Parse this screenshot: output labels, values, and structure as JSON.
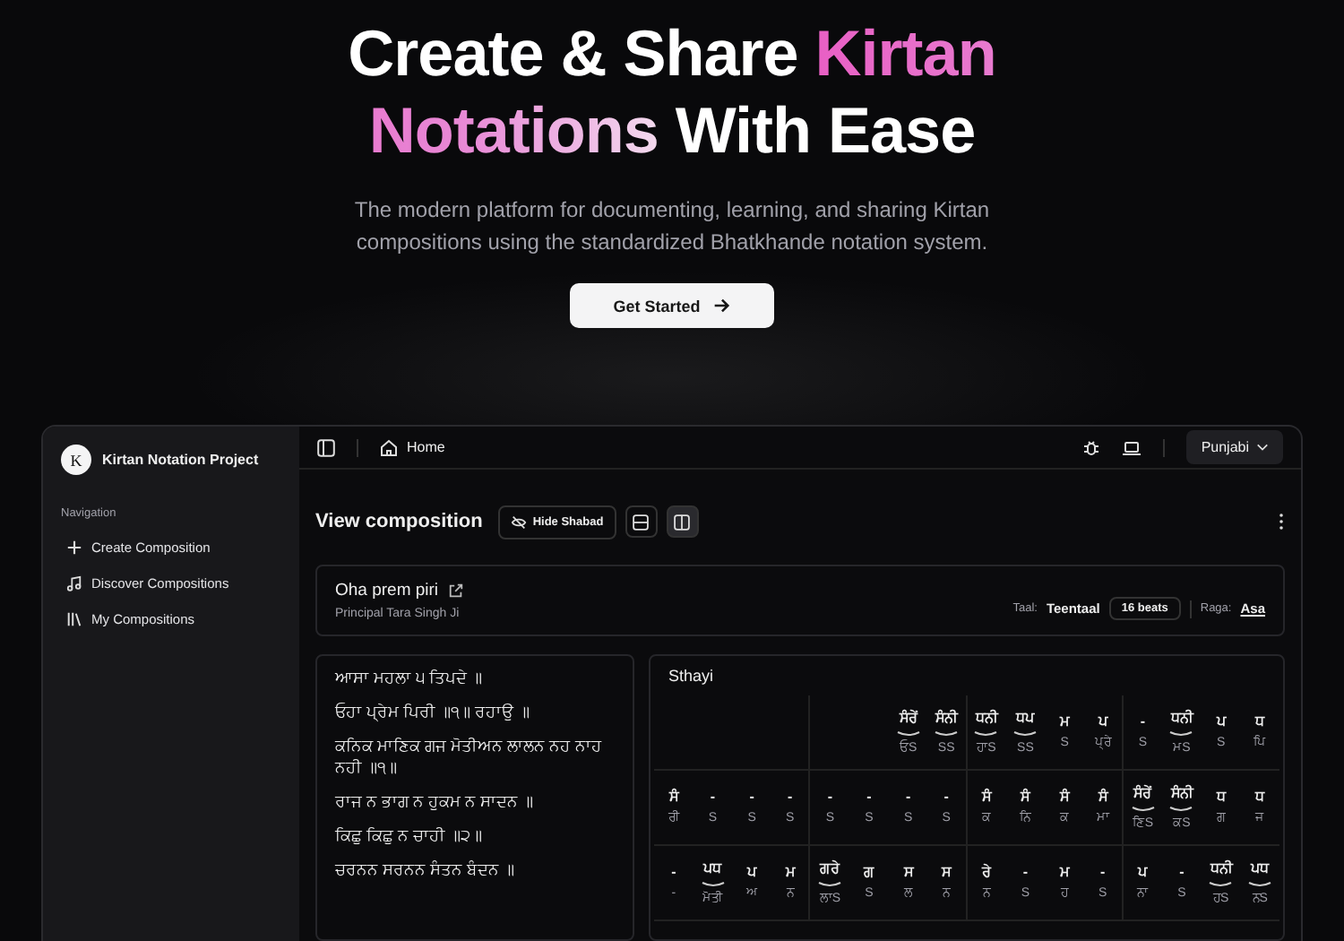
{
  "hero": {
    "title": [
      {
        "text": "Create & Share ",
        "highlight": false
      },
      {
        "text": "Kirtan Notations",
        "highlight": true
      },
      {
        "text": " With Ease",
        "highlight": false
      }
    ],
    "subtitle": "The modern platform for documenting, learning, and sharing Kirtan compositions using the standardized Bhatkhande notation system.",
    "cta": "Get Started"
  },
  "app": {
    "logo_letter": "K",
    "project": "Kirtan Notation Project",
    "sidebar": {
      "heading": "Navigation",
      "items": [
        {
          "label": "Create Composition"
        },
        {
          "label": "Discover Compositions"
        },
        {
          "label": "My Compositions"
        }
      ]
    },
    "breadcrumb": "Home",
    "language": "Punjabi",
    "toolbar": {
      "title": "View composition",
      "hide_button": "Hide Shabad",
      "layouts": [
        {
          "selected": false
        },
        {
          "selected": true
        }
      ]
    },
    "composition": {
      "title": "Oha prem piri",
      "author": "Principal Tara Singh Ji",
      "taal_label": "Taal:",
      "taal": "Teentaal",
      "beats": "16 beats",
      "raga_label": "Raga:",
      "raga": "Asa"
    },
    "shabad": [
      "ਆਸਾ ਮਹਲਾ ੫ ਤਿਪਦੇ ॥",
      "ਓਹਾ ਪ੍ਰੇਮ ਪਿਰੀ ॥੧॥ ਰਹਾਉ ॥",
      "ਕਨਿਕ ਮਾਣਿਕ ਗਜ ਮੋਤੀਅਨ ਲਾਲਨ ਨਹ ਨਾਹ ਨਹੀ ॥੧॥",
      "ਰਾਜ ਨ ਭਾਗ ਨ ਹੁਕਮ ਨ ਸਾਦਨ ॥",
      "ਕਿਛੁ ਕਿਛੁ ਨ ਚਾਹੀ ॥੨॥",
      "ਚਰਨਨ ਸਰਨਨ ਸੰਤਨ ਬੰਦਨ ॥"
    ],
    "section": "Sthayi",
    "rows": [
      {
        "cells": [
          {},
          {},
          {},
          {},
          {},
          {},
          {
            "note": "ਸੰਰੇਂ",
            "lyric": "ਓS",
            "slur": true
          },
          {
            "note": "ਸੰਨੀ",
            "lyric": "SS",
            "slur": true
          },
          {
            "note": "ਧਨੀ",
            "lyric": "ਹਾS",
            "slur": true
          },
          {
            "note": "ਧਪ",
            "lyric": "SS",
            "slur": true
          },
          {
            "note": "ਮ",
            "lyric": "S",
            "slur": false
          },
          {
            "note": "ਪ",
            "lyric": "ਪ੍ਰੇ",
            "slur": false
          },
          {
            "note": "-",
            "lyric": "S",
            "slur": false
          },
          {
            "note": "ਧਨੀ",
            "lyric": "ਮS",
            "slur": true
          },
          {
            "note": "ਪ",
            "lyric": "S",
            "slur": false
          },
          {
            "note": "ਧ",
            "lyric": "ਪਿ",
            "slur": false
          }
        ]
      },
      {
        "cells": [
          {
            "note": "ਸੰ",
            "lyric": "ਰੀ",
            "slur": false
          },
          {
            "note": "-",
            "lyric": "S",
            "slur": false
          },
          {
            "note": "-",
            "lyric": "S",
            "slur": false
          },
          {
            "note": "-",
            "lyric": "S",
            "slur": false
          },
          {
            "note": "-",
            "lyric": "S",
            "slur": false
          },
          {
            "note": "-",
            "lyric": "S",
            "slur": false
          },
          {
            "note": "-",
            "lyric": "S",
            "slur": false
          },
          {
            "note": "-",
            "lyric": "S",
            "slur": false
          },
          {
            "note": "ਸੰ",
            "lyric": "ਕ",
            "slur": false
          },
          {
            "note": "ਸੰ",
            "lyric": "ਨਿ",
            "slur": false
          },
          {
            "note": "ਸੰ",
            "lyric": "ਕ",
            "slur": false
          },
          {
            "note": "ਸੰ",
            "lyric": "ਮਾ",
            "slur": false
          },
          {
            "note": "ਸੰਰੇਂ",
            "lyric": "ਣਿS",
            "slur": true
          },
          {
            "note": "ਸੰਨੀ",
            "lyric": "ਕS",
            "slur": true
          },
          {
            "note": "ਧ",
            "lyric": "ਗ",
            "slur": false
          },
          {
            "note": "ਧ",
            "lyric": "ਜ",
            "slur": false
          }
        ]
      },
      {
        "cells": [
          {
            "note": "-",
            "lyric": "-",
            "slur": false
          },
          {
            "note": "ਪਧ",
            "lyric": "ਮੋਤੀ",
            "slur": true
          },
          {
            "note": "ਪ",
            "lyric": "ਅ",
            "slur": false
          },
          {
            "note": "ਮ",
            "lyric": "ਨ",
            "slur": false
          },
          {
            "note": "ਗਰੇ",
            "lyric": "ਲਾS",
            "slur": true
          },
          {
            "note": "ਗ",
            "lyric": "S",
            "slur": false
          },
          {
            "note": "ਸ",
            "lyric": "ਲ",
            "slur": false
          },
          {
            "note": "ਸ",
            "lyric": "ਨ",
            "slur": false
          },
          {
            "note": "ਰੇ",
            "lyric": "ਨ",
            "slur": false
          },
          {
            "note": "-",
            "lyric": "S",
            "slur": false
          },
          {
            "note": "ਮ",
            "lyric": "ਹ",
            "slur": false
          },
          {
            "note": "-",
            "lyric": "S",
            "slur": false
          },
          {
            "note": "ਪ",
            "lyric": "ਨਾ",
            "slur": false
          },
          {
            "note": "-",
            "lyric": "S",
            "slur": false
          },
          {
            "note": "ਧਨੀ",
            "lyric": "ਹS",
            "slur": true
          },
          {
            "note": "ਪਧ",
            "lyric": "ਨS",
            "slur": true
          }
        ]
      }
    ]
  }
}
